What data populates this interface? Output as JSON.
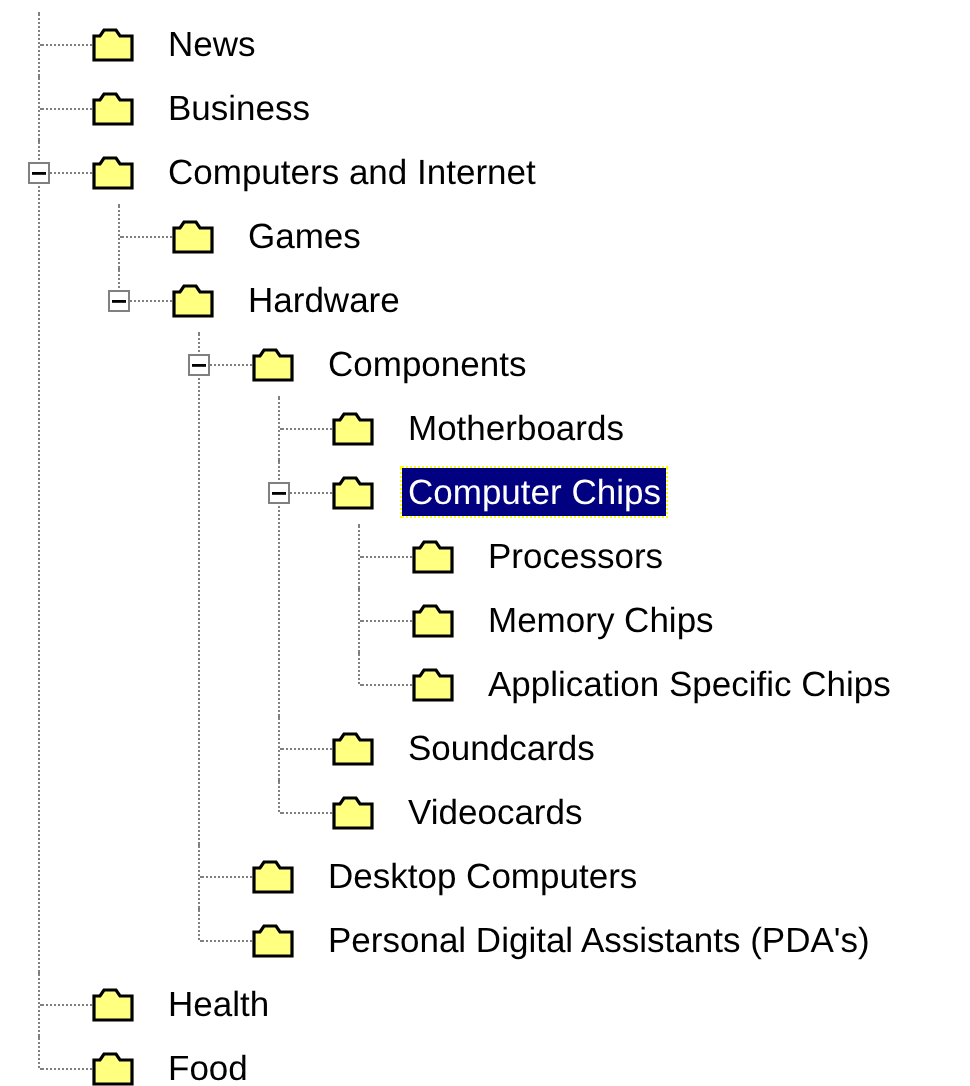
{
  "tree": [
    {
      "label": "News",
      "selected": false
    },
    {
      "label": "Business",
      "selected": false
    },
    {
      "label": "Computers and Internet",
      "selected": false,
      "expanded": true,
      "children": [
        {
          "label": "Games",
          "selected": false
        },
        {
          "label": "Hardware",
          "selected": false,
          "expanded": true,
          "children": [
            {
              "label": "Components",
              "selected": false,
              "expanded": true,
              "children": [
                {
                  "label": "Motherboards",
                  "selected": false
                },
                {
                  "label": "Computer Chips",
                  "selected": true,
                  "expanded": true,
                  "children": [
                    {
                      "label": "Processors",
                      "selected": false
                    },
                    {
                      "label": "Memory Chips",
                      "selected": false
                    },
                    {
                      "label": "Application Specific Chips",
                      "selected": false
                    }
                  ]
                },
                {
                  "label": "Soundcards",
                  "selected": false
                },
                {
                  "label": "Videocards",
                  "selected": false
                }
              ]
            },
            {
              "label": "Desktop Computers",
              "selected": false
            },
            {
              "label": "Personal Digital Assistants (PDA's)",
              "selected": false
            }
          ]
        }
      ]
    },
    {
      "label": "Health",
      "selected": false
    },
    {
      "label": "Food",
      "selected": false
    }
  ]
}
